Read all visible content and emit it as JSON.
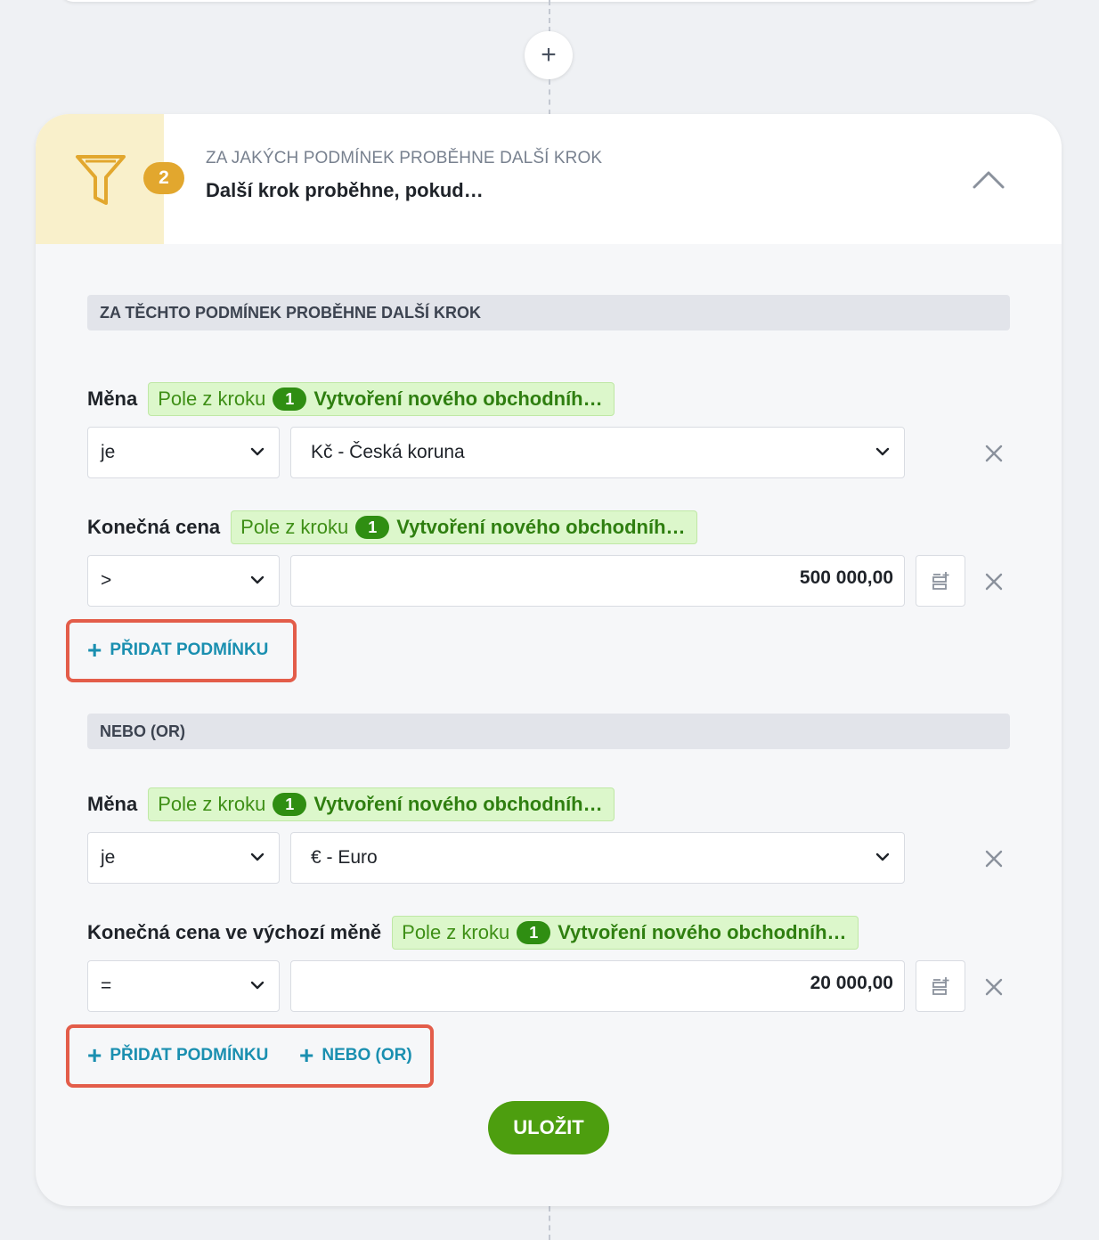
{
  "step_card": {
    "step_number": "2",
    "subtitle": "ZA JAKÝCH PODMÍNEK PROBĚHNE DALŠÍ KROK",
    "title": "Další krok proběhne, pokud…"
  },
  "add_step_symbol": "+",
  "groups": [
    {
      "header": "ZA TĚCHTO PODMÍNEK PROBĚHNE DALŠÍ KROK",
      "conditions": [
        {
          "field": "Měna",
          "tag_prefix": "Pole z kroku",
          "tag_step_num": "1",
          "tag_step_name": "Vytvoření nového obchodníh…",
          "operator": "je",
          "value": "Kč - Česká koruna"
        },
        {
          "field": "Konečná cena",
          "tag_prefix": "Pole z kroku",
          "tag_step_num": "1",
          "tag_step_name": "Vytvoření nového obchodníh…",
          "operator": ">",
          "value": "500 000,00"
        }
      ],
      "add_condition_label": "PŘIDAT PODMÍNKU"
    },
    {
      "header": "NEBO (OR)",
      "conditions": [
        {
          "field": "Měna",
          "tag_prefix": "Pole z kroku",
          "tag_step_num": "1",
          "tag_step_name": "Vytvoření nového obchodníh…",
          "operator": "je",
          "value": "€ - Euro"
        },
        {
          "field": "Konečná cena ve výchozí měně",
          "tag_prefix": "Pole z kroku",
          "tag_step_num": "1",
          "tag_step_name": "Vytvoření nového obchodníh…",
          "operator": "=",
          "value": "20 000,00"
        }
      ],
      "add_condition_label": "PŘIDAT PODMÍNKU",
      "add_or_label": "NEBO (OR)"
    }
  ],
  "save_label": "ULOŽIT",
  "colors": {
    "accent_green": "#4d9e0f",
    "link_blue": "#1a8fb0",
    "badge_amber": "#e2a72e",
    "highlight_red": "#e35d4a"
  }
}
